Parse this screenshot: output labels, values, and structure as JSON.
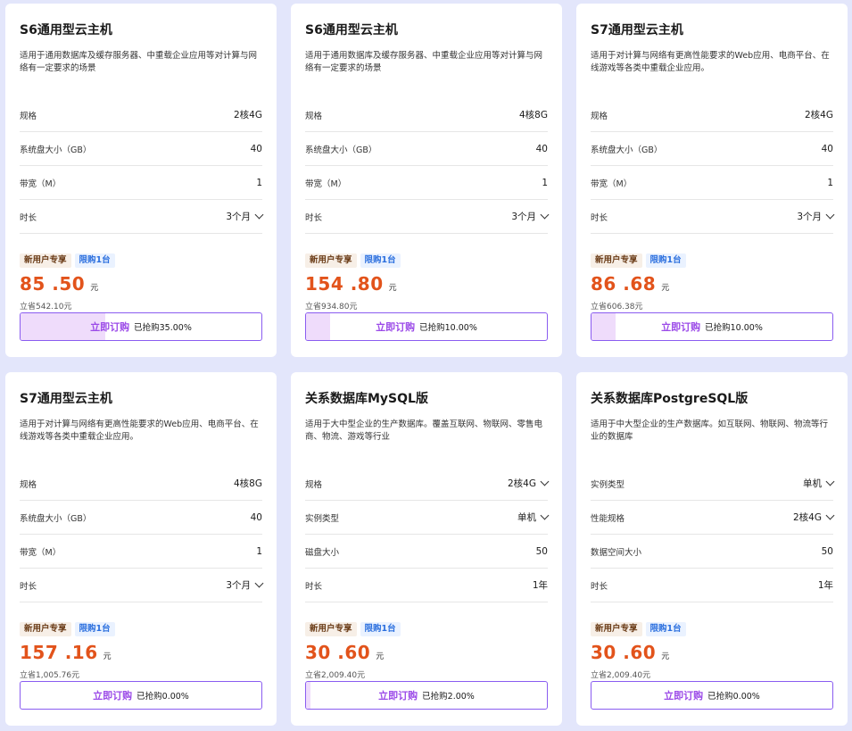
{
  "colors": {
    "background": "#e3e6fb",
    "price": "#e2531b",
    "accent": "#8a5cf0",
    "button_text": "#9b4ae8",
    "progress_fill": "#efdcfb"
  },
  "buy_label": "立即订购",
  "badges": {
    "new_user": "新用户专享",
    "limit": "限购1台"
  },
  "cards": [
    {
      "title": "S6通用型云主机",
      "desc": "适用于通用数据库及缓存服务器、中重载企业应用等对计算与网络有一定要求的场景",
      "specs": [
        {
          "label": "规格",
          "value": "2核4G",
          "dropdown": false
        },
        {
          "label": "系统盘大小（GB）",
          "value": "40",
          "dropdown": false
        },
        {
          "label": "带宽（M）",
          "value": "1",
          "dropdown": false
        },
        {
          "label": "时长",
          "value": "3个月",
          "dropdown": true
        }
      ],
      "price": "85 .50",
      "unit": "元",
      "save": "立省542.10元",
      "progress_text": "已抢购35.00%",
      "progress_pct": 35
    },
    {
      "title": "S6通用型云主机",
      "desc": "适用于通用数据库及缓存服务器、中重载企业应用等对计算与网络有一定要求的场景",
      "specs": [
        {
          "label": "规格",
          "value": "4核8G",
          "dropdown": false
        },
        {
          "label": "系统盘大小（GB）",
          "value": "40",
          "dropdown": false
        },
        {
          "label": "带宽（M）",
          "value": "1",
          "dropdown": false
        },
        {
          "label": "时长",
          "value": "3个月",
          "dropdown": true
        }
      ],
      "price": "154 .80",
      "unit": "元",
      "save": "立省934.80元",
      "progress_text": "已抢购10.00%",
      "progress_pct": 10
    },
    {
      "title": "S7通用型云主机",
      "desc": "适用于对计算与网络有更高性能要求的Web应用、电商平台、在线游戏等各类中重载企业应用。",
      "specs": [
        {
          "label": "规格",
          "value": "2核4G",
          "dropdown": false
        },
        {
          "label": "系统盘大小（GB）",
          "value": "40",
          "dropdown": false
        },
        {
          "label": "带宽（M）",
          "value": "1",
          "dropdown": false
        },
        {
          "label": "时长",
          "value": "3个月",
          "dropdown": true
        }
      ],
      "price": "86 .68",
      "unit": "元",
      "save": "立省606.38元",
      "progress_text": "已抢购10.00%",
      "progress_pct": 10
    },
    {
      "title": "S7通用型云主机",
      "desc": "适用于对计算与网络有更高性能要求的Web应用、电商平台、在线游戏等各类中重载企业应用。",
      "specs": [
        {
          "label": "规格",
          "value": "4核8G",
          "dropdown": false
        },
        {
          "label": "系统盘大小（GB）",
          "value": "40",
          "dropdown": false
        },
        {
          "label": "带宽（M）",
          "value": "1",
          "dropdown": false
        },
        {
          "label": "时长",
          "value": "3个月",
          "dropdown": true
        }
      ],
      "price": "157 .16",
      "unit": "元",
      "save": "立省1,005.76元",
      "progress_text": "已抢购0.00%",
      "progress_pct": 0
    },
    {
      "title": "关系数据库MySQL版",
      "desc": "适用于大中型企业的生产数据库。覆盖互联网、物联网、零售电商、物流、游戏等行业",
      "specs": [
        {
          "label": "规格",
          "value": "2核4G",
          "dropdown": true
        },
        {
          "label": "实例类型",
          "value": "单机",
          "dropdown": true
        },
        {
          "label": "磁盘大小",
          "value": "50",
          "dropdown": false
        },
        {
          "label": "时长",
          "value": "1年",
          "dropdown": false
        }
      ],
      "price": "30 .60",
      "unit": "元",
      "save": "立省2,009.40元",
      "progress_text": "已抢购2.00%",
      "progress_pct": 2
    },
    {
      "title": "关系数据库PostgreSQL版",
      "desc": "适用于中大型企业的生产数据库。如互联网、物联网、物流等行业的数据库",
      "specs": [
        {
          "label": "实例类型",
          "value": "单机",
          "dropdown": true
        },
        {
          "label": "性能规格",
          "value": "2核4G",
          "dropdown": true
        },
        {
          "label": "数据空间大小",
          "value": "50",
          "dropdown": false
        },
        {
          "label": "时长",
          "value": "1年",
          "dropdown": false
        }
      ],
      "price": "30 .60",
      "unit": "元",
      "save": "立省2,009.40元",
      "progress_text": "已抢购0.00%",
      "progress_pct": 0
    }
  ]
}
